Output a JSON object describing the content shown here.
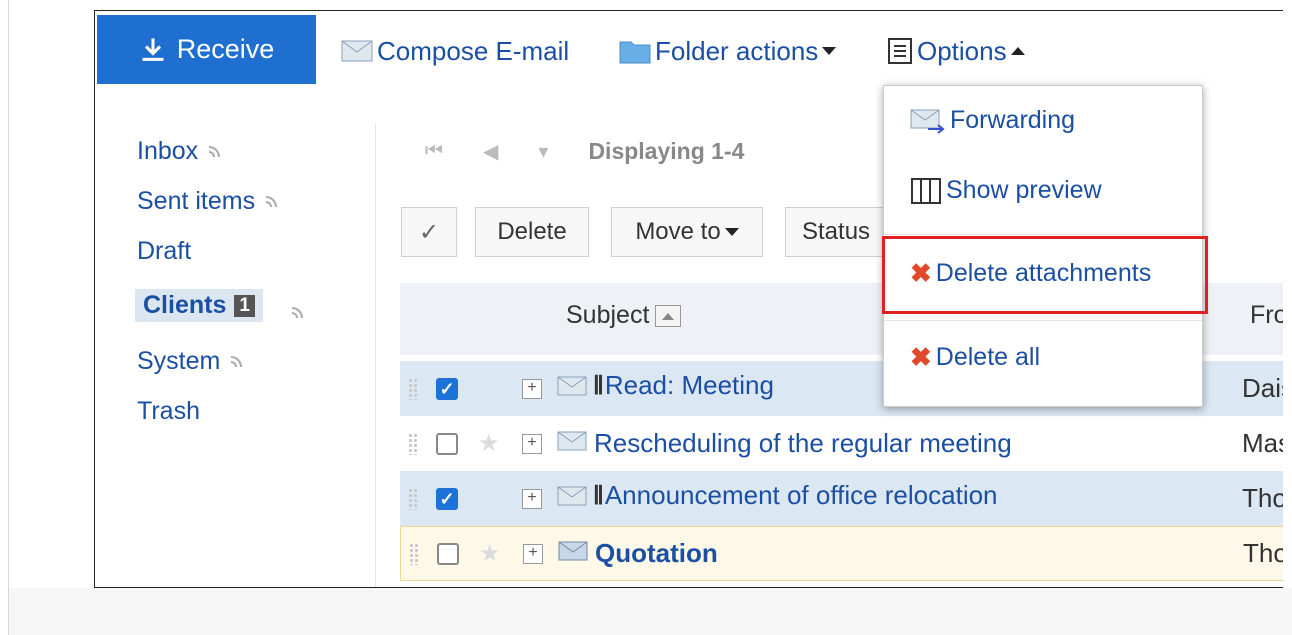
{
  "toolbar": {
    "receive": "Receive",
    "compose": "Compose E-mail",
    "folder_actions": "Folder actions",
    "options": "Options"
  },
  "sidebar": {
    "folders": [
      {
        "label": "Inbox"
      },
      {
        "label": "Sent items"
      },
      {
        "label": "Draft"
      },
      {
        "label": "Clients",
        "count": "1"
      },
      {
        "label": "System"
      },
      {
        "label": "Trash"
      }
    ]
  },
  "pager": {
    "display": "Displaying 1-4"
  },
  "actions": {
    "check": "✓",
    "delete": "Delete",
    "move_to": "Move to",
    "status": "Status"
  },
  "table": {
    "subject_header": "Subject",
    "from_header": "From",
    "rows": [
      {
        "subject": "Read: Meeting",
        "from": "Daisuke",
        "checked": true,
        "attachment": true,
        "unread": false
      },
      {
        "subject": "Rescheduling of the regular meeting",
        "from": "Masaki",
        "checked": false,
        "attachment": false,
        "unread": false
      },
      {
        "subject": "Announcement of office relocation",
        "from": "Thomas",
        "checked": true,
        "attachment": true,
        "unread": false
      },
      {
        "subject": "Quotation",
        "from": "Thomas",
        "checked": false,
        "attachment": false,
        "unread": true
      }
    ]
  },
  "options_menu": {
    "forwarding": "Forwarding",
    "show_preview": "Show preview",
    "delete_attachments": "Delete attachments",
    "delete_all": "Delete all"
  },
  "colors": {
    "accent": "#1f6fd0",
    "link": "#1b4fa3",
    "highlight": "#e02020"
  }
}
